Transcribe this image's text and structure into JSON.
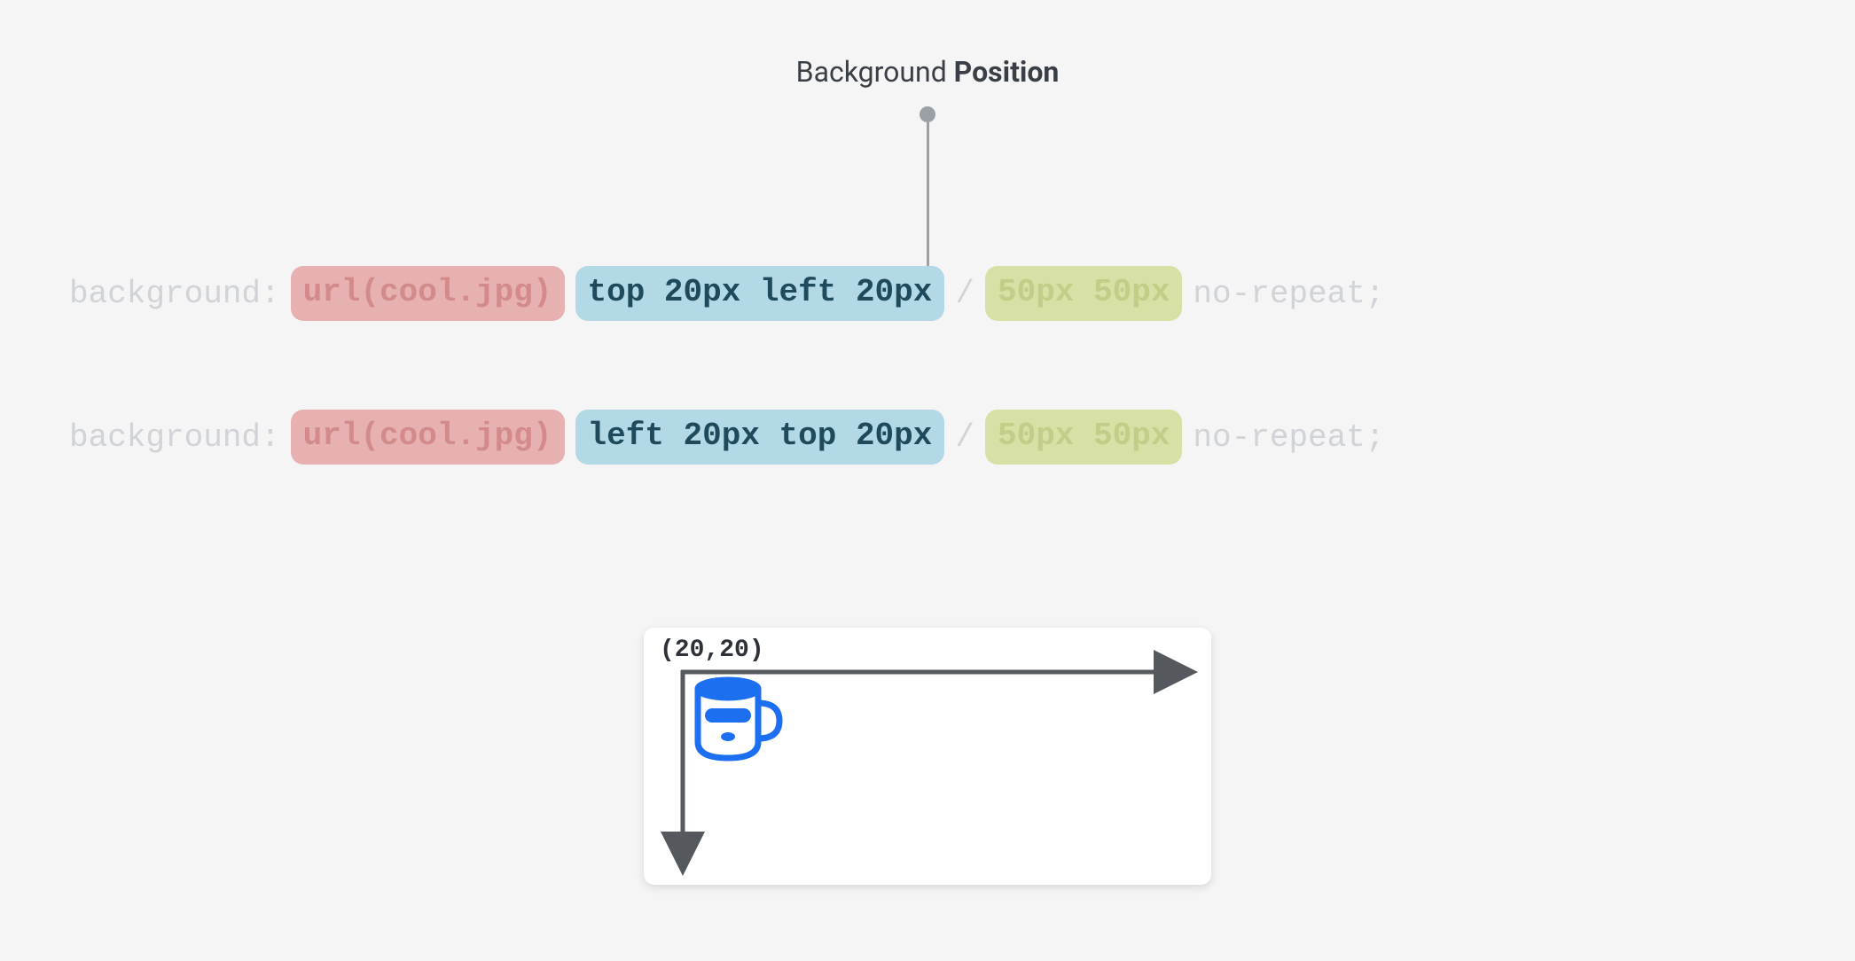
{
  "title": {
    "prefix": "Background ",
    "bold": "Position"
  },
  "code": {
    "line1": {
      "property": "background:",
      "url": "url(cool.jpg)",
      "position": "top 20px left 20px",
      "separator": "/",
      "size": "50px 50px",
      "repeat": "no-repeat;"
    },
    "line2": {
      "property": "background:",
      "url": "url(cool.jpg)",
      "position": "left 20px top 20px",
      "separator": "/",
      "size": "50px 50px",
      "repeat": "no-repeat;"
    }
  },
  "diagram": {
    "coord_label": "(20,20)"
  },
  "colors": {
    "pill_red_bg": "#e8b1b1",
    "pill_blue_bg": "#b3d9e6",
    "pill_green_bg": "#d7e0a5",
    "accent_blue": "#1d6ff2",
    "muted_text": "#d0d3d7",
    "axis": "#55585c"
  }
}
